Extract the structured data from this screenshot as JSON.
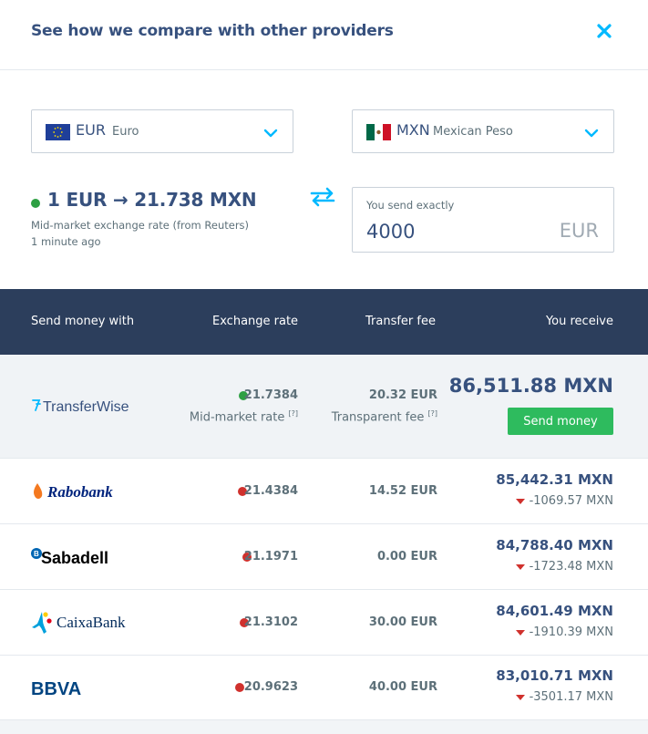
{
  "header": {
    "title": "See how we compare with other providers",
    "close_icon": "close-icon"
  },
  "from_currency": {
    "code": "EUR",
    "name": "Euro",
    "flag": "eu-flag-icon"
  },
  "to_currency": {
    "code": "MXN",
    "name": "Mexican Peso",
    "flag": "mx-flag-icon"
  },
  "rate": {
    "summary": "1 EUR → 21.738 MXN",
    "source": "Mid-market exchange rate (from Reuters)",
    "updated": "1 minute ago"
  },
  "send": {
    "label": "You send exactly",
    "value": "4000",
    "currency": "EUR"
  },
  "table": {
    "headers": [
      "Send money with",
      "Exchange rate",
      "Transfer fee",
      "You receive"
    ],
    "featured": {
      "provider": "TransferWise",
      "rate": "21.7384",
      "rate_note": "Mid-market rate",
      "fee": "20.32 EUR",
      "fee_note": "Transparent fee",
      "help_mark": "[?]",
      "receive": "86,511.88 MXN",
      "button": "Send money"
    },
    "rows": [
      {
        "provider": "Rabobank",
        "rate": "21.4384",
        "fee": "14.52 EUR",
        "receive": "85,442.31 MXN",
        "diff": "-1069.57 MXN"
      },
      {
        "provider": "Sabadell",
        "rate": "21.1971",
        "fee": "0.00 EUR",
        "receive": "84,788.40 MXN",
        "diff": "-1723.48 MXN"
      },
      {
        "provider": "CaixaBank",
        "rate": "21.3102",
        "fee": "30.00 EUR",
        "receive": "84,601.49 MXN",
        "diff": "-1910.39 MXN"
      },
      {
        "provider": "BBVA",
        "rate": "20.9623",
        "fee": "40.00 EUR",
        "receive": "83,010.71 MXN",
        "diff": "-3501.17 MXN"
      }
    ]
  },
  "colors": {
    "navy": "#2c3e5c",
    "accent_blue": "#00b9ff",
    "green": "#2ebb5e",
    "red": "#d0312d",
    "text": "#37517e"
  }
}
